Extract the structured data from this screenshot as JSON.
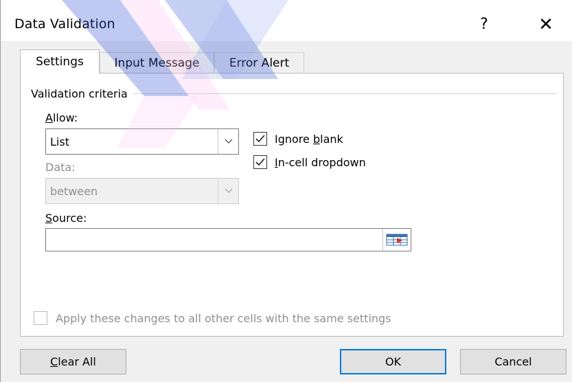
{
  "dialog": {
    "title": "Data Validation",
    "help_glyph": "?",
    "close_glyph": "✕"
  },
  "tabs": [
    {
      "label": "Settings",
      "active": true
    },
    {
      "label": "Input Message",
      "active": false
    },
    {
      "label": "Error Alert",
      "active": false
    }
  ],
  "settings": {
    "group_label": "Validation criteria",
    "allow": {
      "label_ul": "A",
      "label_rest": "llow:",
      "value": "List"
    },
    "data": {
      "label": "Data:",
      "value": "between",
      "disabled": true
    },
    "ignore_blank": {
      "label_pre": "Ignore ",
      "label_ul": "b",
      "label_rest": "lank",
      "checked": true
    },
    "in_cell_dropdown": {
      "label_ul": "I",
      "label_rest": "n-cell dropdown",
      "checked": true
    },
    "source": {
      "label_ul": "S",
      "label_rest": "ource:",
      "value": ""
    },
    "apply_all": {
      "label": "Apply these changes to all other cells with the same settings",
      "checked": false,
      "disabled": true
    }
  },
  "buttons": {
    "clear_all_ul": "C",
    "clear_all_rest": "lear All",
    "ok": "OK",
    "cancel": "Cancel"
  },
  "icons": {
    "range_selector": "collapse-range-icon",
    "dropdown": "chevron-down-icon"
  },
  "colors": {
    "default_button_border": "#0078d7",
    "panel_bg": "#ffffff",
    "dialog_bg": "#f0f0f0"
  }
}
